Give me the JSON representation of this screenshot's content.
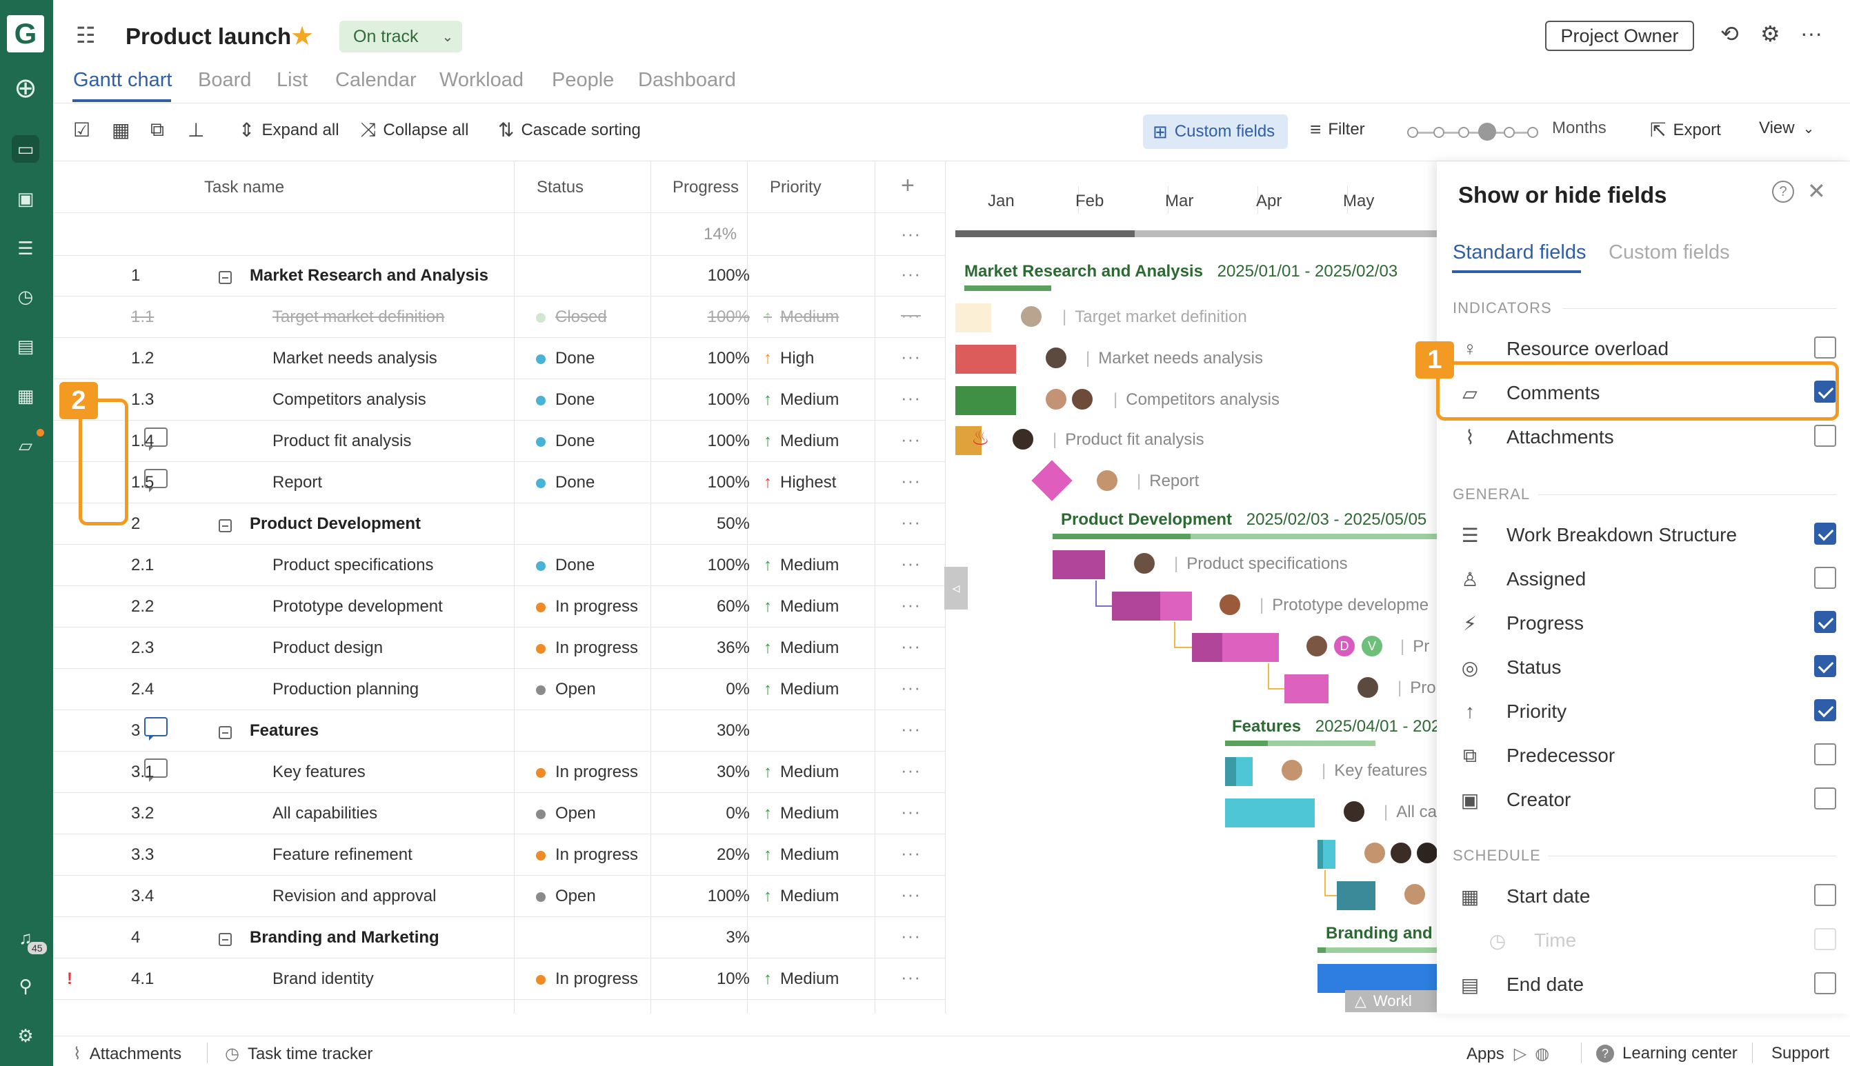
{
  "header": {
    "title": "Product launch",
    "status": "On track",
    "owner_button": "Project Owner"
  },
  "tabs": [
    "Gantt chart",
    "Board",
    "List",
    "Calendar",
    "Workload",
    "People",
    "Dashboard"
  ],
  "toolbar": {
    "expand_all": "Expand all",
    "collapse_all": "Collapse all",
    "cascade_sorting": "Cascade sorting",
    "custom_fields": "Custom fields",
    "filter": "Filter",
    "zoom": "Months",
    "export": "Export",
    "view": "View"
  },
  "grid": {
    "headers": {
      "task": "Task name",
      "status": "Status",
      "progress": "Progress",
      "priority": "Priority"
    },
    "project_progress": "14%",
    "rows": [
      {
        "wbs": "1",
        "name": "Market Research and Analysis",
        "status": "",
        "progress": "100%",
        "priority": "",
        "group": true
      },
      {
        "wbs": "1.1",
        "name": "Target market definition",
        "status": "Closed",
        "progress": "100%",
        "priority": "Medium",
        "status_color": "#cfe8cf",
        "priority_color": "#9ccc9c",
        "struck": true
      },
      {
        "wbs": "1.2",
        "name": "Market needs analysis",
        "status": "Done",
        "progress": "100%",
        "priority": "High",
        "status_color": "#49b3d6",
        "priority_color": "#f08a24"
      },
      {
        "wbs": "1.3",
        "name": "Competitors analysis",
        "status": "Done",
        "progress": "100%",
        "priority": "Medium",
        "status_color": "#49b3d6",
        "priority_color": "#3a9a45"
      },
      {
        "wbs": "1.4",
        "name": "Product fit analysis",
        "status": "Done",
        "progress": "100%",
        "priority": "Medium",
        "status_color": "#49b3d6",
        "priority_color": "#3a9a45",
        "comment": true
      },
      {
        "wbs": "1.5",
        "name": "Report",
        "status": "Done",
        "progress": "100%",
        "priority": "Highest",
        "status_color": "#49b3d6",
        "priority_color": "#e0383e",
        "comment": true
      },
      {
        "wbs": "2",
        "name": "Product Development",
        "status": "",
        "progress": "50%",
        "priority": "",
        "group": true
      },
      {
        "wbs": "2.1",
        "name": "Product specifications",
        "status": "Done",
        "progress": "100%",
        "priority": "Medium",
        "status_color": "#49b3d6",
        "priority_color": "#3a9a45"
      },
      {
        "wbs": "2.2",
        "name": "Prototype development",
        "status": "In progress",
        "progress": "60%",
        "priority": "Medium",
        "status_color": "#f08a24",
        "priority_color": "#3a9a45"
      },
      {
        "wbs": "2.3",
        "name": "Product design",
        "status": "In progress",
        "progress": "36%",
        "priority": "Medium",
        "status_color": "#f08a24",
        "priority_color": "#3a9a45"
      },
      {
        "wbs": "2.4",
        "name": "Production planning",
        "status": "Open",
        "progress": "0%",
        "priority": "Medium",
        "status_color": "#8a8a8a",
        "priority_color": "#3a9a45"
      },
      {
        "wbs": "3",
        "name": "Features",
        "status": "",
        "progress": "30%",
        "priority": "",
        "group": true,
        "comment_blue": true
      },
      {
        "wbs": "3.1",
        "name": "Key features",
        "status": "In progress",
        "progress": "30%",
        "priority": "Medium",
        "status_color": "#f08a24",
        "priority_color": "#3a9a45",
        "comment": true
      },
      {
        "wbs": "3.2",
        "name": "All capabilities",
        "status": "Open",
        "progress": "0%",
        "priority": "Medium",
        "status_color": "#8a8a8a",
        "priority_color": "#3a9a45"
      },
      {
        "wbs": "3.3",
        "name": "Feature refinement",
        "status": "In progress",
        "progress": "20%",
        "priority": "Medium",
        "status_color": "#f08a24",
        "priority_color": "#3a9a45"
      },
      {
        "wbs": "3.4",
        "name": "Revision and approval",
        "status": "Open",
        "progress": "100%",
        "priority": "Medium",
        "status_color": "#8a8a8a",
        "priority_color": "#3a9a45"
      },
      {
        "wbs": "4",
        "name": "Branding and Marketing",
        "status": "",
        "progress": "3%",
        "priority": "",
        "group": true
      },
      {
        "wbs": "4.1",
        "name": "Brand identity",
        "status": "In progress",
        "progress": "10%",
        "priority": "Medium",
        "status_color": "#f08a24",
        "priority_color": "#3a9a45",
        "flag": "!"
      }
    ]
  },
  "gantt": {
    "months": [
      "Jan",
      "Feb",
      "Mar",
      "Apr",
      "May"
    ],
    "summaries": {
      "market": {
        "name": "Market Research and Analysis",
        "dates": "2025/01/01 - 2025/02/03"
      },
      "product": {
        "name": "Product Development",
        "dates": "2025/02/03 - 2025/05/05"
      },
      "features": {
        "name": "Features",
        "dates": "2025/04/01 - 202"
      },
      "branding": {
        "name": "Branding and"
      }
    },
    "labels": {
      "target": "Target market definition",
      "needs": "Market needs analysis",
      "competitors": "Competitors analysis",
      "fit": "Product fit analysis",
      "report": "Report",
      "specs": "Product specifications",
      "prototype": "Prototype developme",
      "design": "Pr",
      "planning": "Pro",
      "key": "Key features",
      "all": "All ca",
      "workload": "Workl"
    },
    "avatar_letters": [
      "D",
      "V"
    ]
  },
  "panel": {
    "title": "Show or hide fields",
    "tabs": [
      "Standard fields",
      "Custom fields"
    ],
    "sections": {
      "indicators": "INDICATORS",
      "general": "GENERAL",
      "schedule": "SCHEDULE"
    },
    "indicators": [
      {
        "label": "Resource overload",
        "checked": false,
        "icon": "person-icon"
      },
      {
        "label": "Comments",
        "checked": true,
        "icon": "comment-icon"
      },
      {
        "label": "Attachments",
        "checked": false,
        "icon": "paperclip-icon"
      }
    ],
    "general": [
      {
        "label": "Work Breakdown Structure",
        "checked": true,
        "icon": "lines-icon"
      },
      {
        "label": "Assigned",
        "checked": false,
        "icon": "user-icon"
      },
      {
        "label": "Progress",
        "checked": true,
        "icon": "progress-icon"
      },
      {
        "label": "Status",
        "checked": true,
        "icon": "status-icon"
      },
      {
        "label": "Priority",
        "checked": true,
        "icon": "arrow-up-icon"
      },
      {
        "label": "Predecessor",
        "checked": false,
        "icon": "predecessor-icon"
      },
      {
        "label": "Creator",
        "checked": false,
        "icon": "creator-icon"
      }
    ],
    "schedule": [
      {
        "label": "Start date",
        "checked": false,
        "icon": "calendar-icon"
      },
      {
        "label": "Time",
        "checked": false,
        "icon": "clock-icon",
        "dim": true
      },
      {
        "label": "End date",
        "checked": false,
        "icon": "calendar-end-icon"
      }
    ]
  },
  "callouts": [
    "1",
    "2"
  ],
  "footer": {
    "attachments": "Attachments",
    "time_tracker": "Task time tracker",
    "apps": "Apps",
    "learning": "Learning center",
    "support": "Support"
  },
  "rail": {
    "notifications": "45"
  },
  "colors": {
    "rail": "#1e6b4f",
    "accent": "#2f5ea8",
    "callout": "#f29a22"
  }
}
